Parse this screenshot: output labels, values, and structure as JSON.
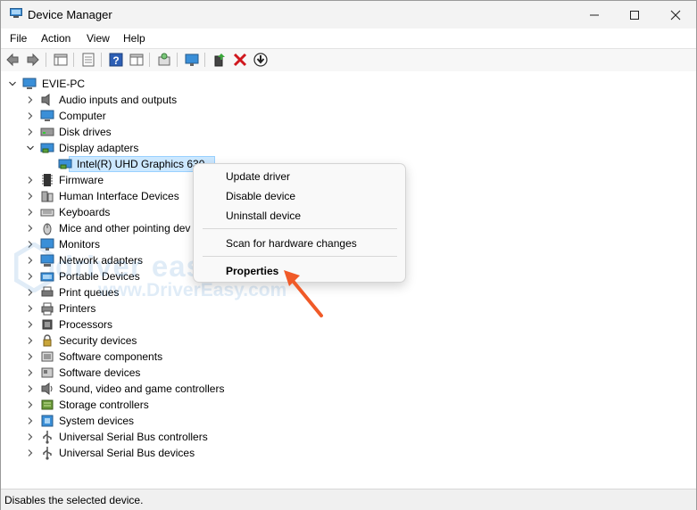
{
  "window": {
    "title": "Device Manager"
  },
  "menubar": [
    "File",
    "Action",
    "View",
    "Help"
  ],
  "tree": {
    "root": "EVIE-PC",
    "categories": [
      {
        "label": "Audio inputs and outputs",
        "icon": "speaker-icon"
      },
      {
        "label": "Computer",
        "icon": "computer-icon"
      },
      {
        "label": "Disk drives",
        "icon": "disk-drive-icon"
      },
      {
        "label": "Display adapters",
        "icon": "display-adapter-icon",
        "expanded": true
      },
      {
        "label": "Intel(R) UHD Graphics 630",
        "icon": "display-adapter-icon",
        "child": true,
        "selected": true
      },
      {
        "label": "Firmware",
        "icon": "firmware-icon"
      },
      {
        "label": "Human Interface Devices",
        "icon": "hid-icon"
      },
      {
        "label": "Keyboards",
        "icon": "keyboard-icon"
      },
      {
        "label": "Mice and other pointing dev",
        "icon": "mouse-icon"
      },
      {
        "label": "Monitors",
        "icon": "monitor-icon"
      },
      {
        "label": "Network adapters",
        "icon": "network-adapter-icon"
      },
      {
        "label": "Portable Devices",
        "icon": "portable-device-icon"
      },
      {
        "label": "Print queues",
        "icon": "print-queue-icon"
      },
      {
        "label": "Printers",
        "icon": "printer-icon"
      },
      {
        "label": "Processors",
        "icon": "processor-icon"
      },
      {
        "label": "Security devices",
        "icon": "security-device-icon"
      },
      {
        "label": "Software components",
        "icon": "software-component-icon"
      },
      {
        "label": "Software devices",
        "icon": "software-device-icon"
      },
      {
        "label": "Sound, video and game controllers",
        "icon": "sound-controller-icon"
      },
      {
        "label": "Storage controllers",
        "icon": "storage-controller-icon"
      },
      {
        "label": "System devices",
        "icon": "system-device-icon"
      },
      {
        "label": "Universal Serial Bus controllers",
        "icon": "usb-controller-icon"
      },
      {
        "label": "Universal Serial Bus devices",
        "icon": "usb-device-icon"
      }
    ]
  },
  "context_menu": {
    "items": [
      "Update driver",
      "Disable device",
      "Uninstall device",
      "Scan for hardware changes",
      "Properties"
    ]
  },
  "watermark": {
    "brand": "driver easy",
    "url": "www.DriverEasy.com"
  },
  "status": {
    "text": "Disables the selected device."
  },
  "colors": {
    "accent_arrow": "#f05a28",
    "selection": "#cce8ff"
  }
}
